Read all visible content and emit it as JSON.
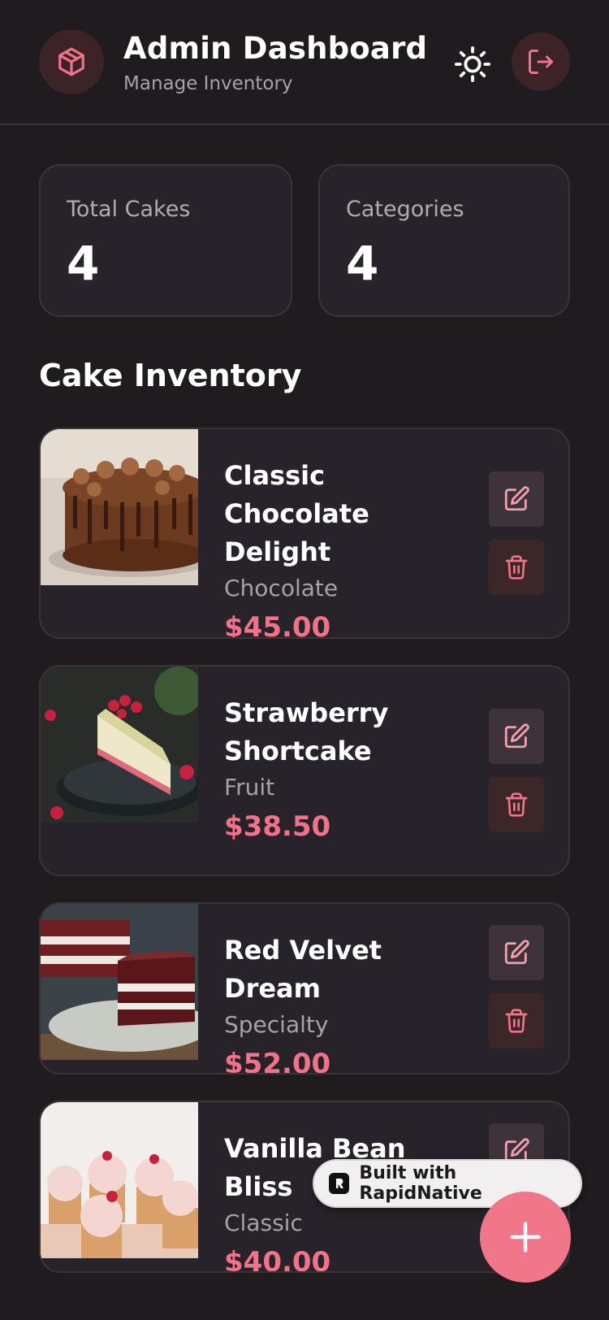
{
  "header": {
    "title": "Admin Dashboard",
    "subtitle": "Manage Inventory",
    "logo_icon": "package-icon",
    "theme_icon": "sun-icon",
    "logout_icon": "logout-icon"
  },
  "stats": [
    {
      "label": "Total Cakes",
      "value": "4"
    },
    {
      "label": "Categories",
      "value": "4"
    }
  ],
  "section_title": "Cake Inventory",
  "cakes": [
    {
      "name": "Classic Chocolate Delight",
      "category": "Chocolate",
      "price": "$45.00",
      "image_icon": "chocolate-cake-image"
    },
    {
      "name": "Strawberry Shortcake",
      "category": "Fruit",
      "price": "$38.50",
      "image_icon": "strawberry-cake-image"
    },
    {
      "name": "Red Velvet Dream",
      "category": "Specialty",
      "price": "$52.00",
      "image_icon": "red-velvet-cake-image"
    },
    {
      "name": "Vanilla Bean Bliss",
      "category": "Classic",
      "price": "$40.00",
      "image_icon": "vanilla-cupcakes-image"
    }
  ],
  "badge": {
    "label": "Built with RapidNative"
  },
  "fab_icon": "plus-icon",
  "colors": {
    "accent": "#f2728a",
    "background": "#1f1b1e",
    "card": "#28232a"
  }
}
